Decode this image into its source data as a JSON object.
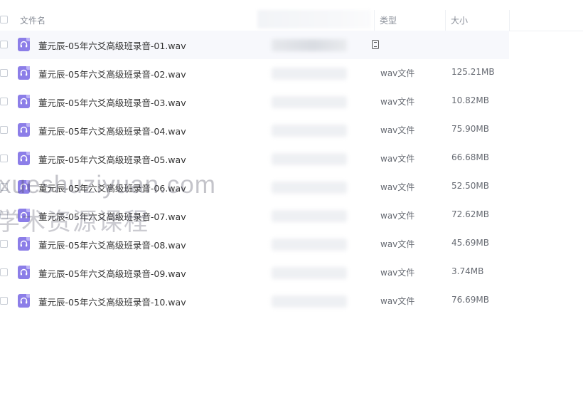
{
  "header": {
    "name_label": "文件名",
    "type_label": "类型",
    "size_label": "大小"
  },
  "files": [
    {
      "name": "董元辰-05年六爻高级班录音-01.wav",
      "type": "",
      "size": ""
    },
    {
      "name": "董元辰-05年六爻高级班录音-02.wav",
      "type": "wav文件",
      "size": "125.21MB"
    },
    {
      "name": "董元辰-05年六爻高级班录音-03.wav",
      "type": "wav文件",
      "size": "10.82MB"
    },
    {
      "name": "董元辰-05年六爻高级班录音-04.wav",
      "type": "wav文件",
      "size": "75.90MB"
    },
    {
      "name": "董元辰-05年六爻高级班录音-05.wav",
      "type": "wav文件",
      "size": "66.68MB"
    },
    {
      "name": "董元辰-05年六爻高级班录音-06.wav",
      "type": "wav文件",
      "size": "52.50MB"
    },
    {
      "name": "董元辰-05年六爻高级班录音-07.wav",
      "type": "wav文件",
      "size": "72.62MB"
    },
    {
      "name": "董元辰-05年六爻高级班录音-08.wav",
      "type": "wav文件",
      "size": "45.69MB"
    },
    {
      "name": "董元辰-05年六爻高级班录音-09.wav",
      "type": "wav文件",
      "size": "3.74MB"
    },
    {
      "name": "董元辰-05年六爻高级班录音-10.wav",
      "type": "wav文件",
      "size": "76.69MB"
    }
  ],
  "icons": {
    "file": "audio-file-icon",
    "row_action": "document-icon"
  },
  "colors": {
    "file_icon": "#8c7ee8",
    "selected_row": "#f7f8fc"
  },
  "watermark": {
    "line1": "xueshuziyuan.com",
    "line2": "学术资源课程"
  }
}
